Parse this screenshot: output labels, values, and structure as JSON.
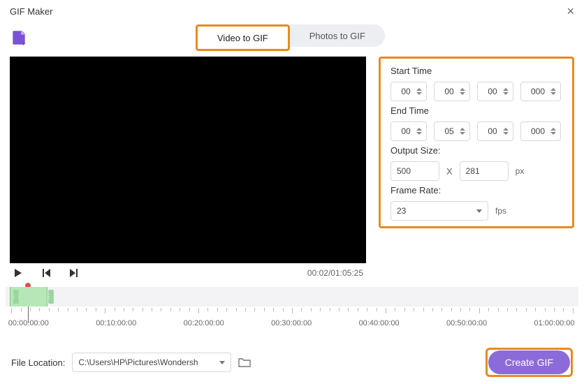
{
  "window": {
    "title": "GIF Maker"
  },
  "tabs": {
    "video_to_gif": "Video to GIF",
    "photos_to_gif": "Photos to GIF"
  },
  "playback": {
    "time_readout": "00:02/01:05:25"
  },
  "settings": {
    "start_time_label": "Start Time",
    "start": {
      "h": "00",
      "m": "00",
      "s": "00",
      "ms": "000"
    },
    "end_time_label": "End Time",
    "end": {
      "h": "00",
      "m": "05",
      "s": "00",
      "ms": "000"
    },
    "output_size_label": "Output Size:",
    "output_width": "500",
    "output_height": "281",
    "size_unit": "px",
    "size_x": "X",
    "frame_rate_label": "Frame Rate:",
    "frame_rate_value": "23",
    "frame_rate_unit": "fps"
  },
  "timeline": {
    "labels": [
      "00:00:00:00",
      "00:10:00:00",
      "00:20:00:00",
      "00:30:00:00",
      "00:40:00:00",
      "00:50:00:00",
      "01:00:00:00"
    ]
  },
  "footer": {
    "file_location_label": "File Location:",
    "path": "C:\\Users\\HP\\Pictures\\Wondersh",
    "create_button": "Create GIF"
  }
}
